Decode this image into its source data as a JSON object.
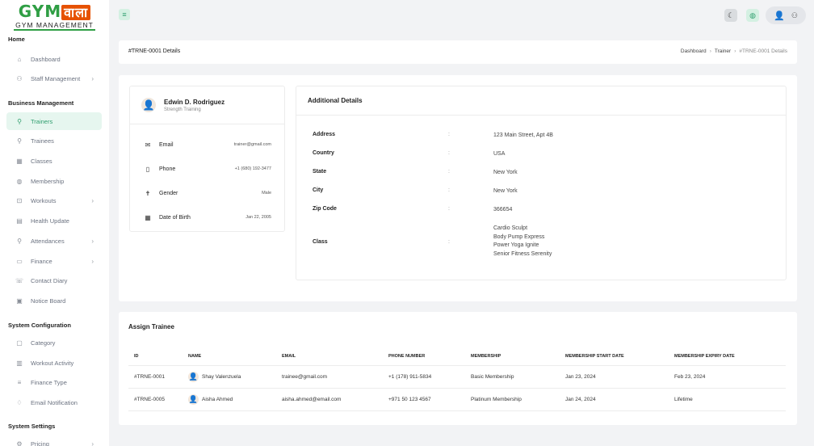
{
  "brand": {
    "logo_gym": "GYM",
    "logo_wala": "वाला",
    "subtitle": "GYM MANAGEMENT"
  },
  "sidebar": {
    "sections": [
      {
        "title": "Home",
        "items": [
          {
            "label": "Dashboard",
            "icon": "home-icon",
            "chevron": false,
            "active": false
          },
          {
            "label": "Staff Management",
            "icon": "users-icon",
            "chevron": true,
            "active": false
          }
        ]
      },
      {
        "title": "Business Management",
        "items": [
          {
            "label": "Trainers",
            "icon": "user-plus-icon",
            "chevron": false,
            "active": true
          },
          {
            "label": "Trainees",
            "icon": "user-icon",
            "chevron": false,
            "active": false
          },
          {
            "label": "Classes",
            "icon": "calendar-icon",
            "chevron": false,
            "active": false
          },
          {
            "label": "Membership",
            "icon": "globe-icon",
            "chevron": false,
            "active": false
          },
          {
            "label": "Workouts",
            "icon": "dumbbell-icon",
            "chevron": true,
            "active": false
          },
          {
            "label": "Health Update",
            "icon": "clipboard-icon",
            "chevron": false,
            "active": false
          },
          {
            "label": "Attendances",
            "icon": "user-check-icon",
            "chevron": true,
            "active": false
          },
          {
            "label": "Finance",
            "icon": "wallet-icon",
            "chevron": true,
            "active": false
          },
          {
            "label": "Contact Diary",
            "icon": "phone-book-icon",
            "chevron": false,
            "active": false
          },
          {
            "label": "Notice Board",
            "icon": "board-icon",
            "chevron": false,
            "active": false
          }
        ]
      },
      {
        "title": "System Configuration",
        "items": [
          {
            "label": "Category",
            "icon": "tag-icon",
            "chevron": false,
            "active": false
          },
          {
            "label": "Workout Activity",
            "icon": "activity-icon",
            "chevron": false,
            "active": false
          },
          {
            "label": "Finance Type",
            "icon": "list-icon",
            "chevron": false,
            "active": false
          },
          {
            "label": "Email Notification",
            "icon": "bell-icon",
            "chevron": false,
            "active": false
          }
        ]
      },
      {
        "title": "System Settings",
        "items": [
          {
            "label": "Pricing",
            "icon": "settings-icon",
            "chevron": true,
            "active": false
          }
        ]
      }
    ]
  },
  "topbar": {
    "icons": [
      "menu-icon",
      "moon-icon",
      "globe-icon",
      "avatar-icon",
      "user-settings-icon"
    ]
  },
  "header": {
    "title": "#TRNE-0001 Details",
    "breadcrumb": [
      "Dashboard",
      "Trainer",
      "#TRNE-0001 Details"
    ]
  },
  "profile": {
    "name": "Edwin D. Rodriguez",
    "role": "Strength Training",
    "fields": [
      {
        "label": "Email",
        "value": "trainer@gmail.com",
        "icon": "mail-icon"
      },
      {
        "label": "Phone",
        "value": "+1 (680) 192-3477",
        "icon": "phone-icon"
      },
      {
        "label": "Gender",
        "value": "Male",
        "icon": "gender-icon"
      },
      {
        "label": "Date of Birth",
        "value": "Jan 22, 2005",
        "icon": "calendar-icon"
      }
    ]
  },
  "additional": {
    "title": "Additional Details",
    "rows": [
      {
        "label": "Address",
        "value": [
          "123 Main Street, Apt 4B"
        ]
      },
      {
        "label": "Country",
        "value": [
          "USA"
        ]
      },
      {
        "label": "State",
        "value": [
          "New York"
        ]
      },
      {
        "label": "City",
        "value": [
          "New York"
        ]
      },
      {
        "label": "Zip Code",
        "value": [
          "366654"
        ]
      },
      {
        "label": "Class",
        "value": [
          "Cardio Sculpt",
          "Body Pump Express",
          "Power Yoga Ignite",
          "Senior Fitness Serenity"
        ]
      }
    ]
  },
  "assign": {
    "title": "Assign Trainee",
    "columns": [
      "ID",
      "NAME",
      "EMAIL",
      "PHONE NUMBER",
      "MEMBERSHIP",
      "MEMBERSHIP START DATE",
      "MEMBERSHIP EXPIRY DATE"
    ],
    "rows": [
      [
        "#TRNE-0001",
        "Shay Valenzuela",
        "trainee@gmail.com",
        "+1 (178) 911-5834",
        "Basic Membership",
        "Jan 23, 2024",
        "Feb 23, 2024"
      ],
      [
        "#TRNE-0005",
        "Aisha Ahmed",
        "aisha.ahmed@email.com",
        "+971 50 123 4567",
        "Platinum Membership",
        "Jan 24, 2024",
        "Lifetime"
      ]
    ]
  },
  "colors": {
    "accent": "#2f9e6e",
    "active_bg": "#e6f6ef",
    "brand_green": "#2f9e44",
    "brand_orange": "#e65100"
  }
}
